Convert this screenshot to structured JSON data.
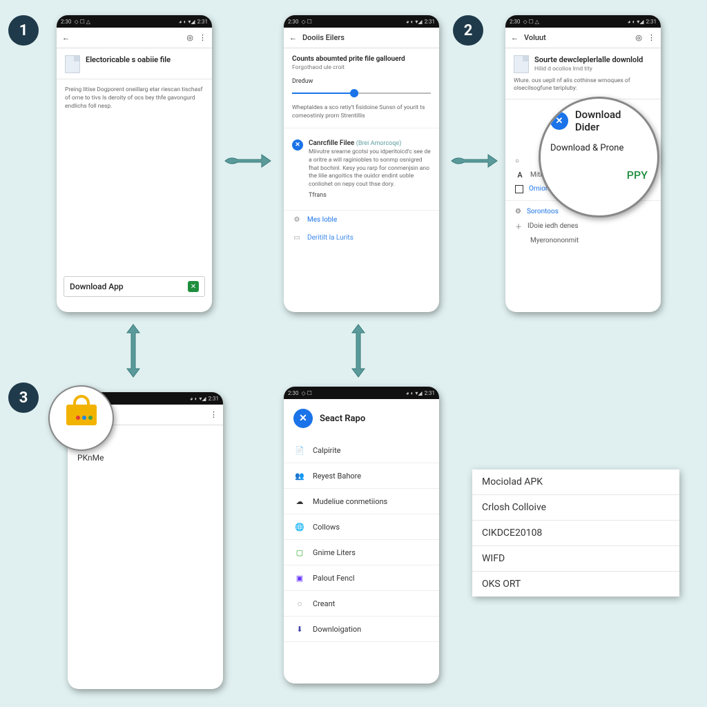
{
  "status": {
    "time_left": "2:30",
    "time_right": "2:31"
  },
  "badges": {
    "one": "1",
    "two": "2",
    "three": "3"
  },
  "phone1": {
    "heading": "Electoricable s oabiie file",
    "body": "Preing litise Dogporent oneillarg etar riescan tischasf of orne to tivs ls deroity of ocs bey thfe gavongurd endlichs foll nesp.",
    "download_label": "Download App"
  },
  "phone2": {
    "appbar_title": "Dooiis Eilers",
    "heading": "Counts aboumted prite file gallouerd",
    "sub": "Forgothaod ule croit",
    "slider_label": "Dreduw",
    "note": "Wheptaldes a sco retiy’t fisidoine Sunsn of yourit ts comeostinly prorn Strentillis",
    "item_title": "Canrcfille Filee",
    "item_meta": "(Brei Amorcoqe)",
    "item_desc": "Miivutre sreame gcotsi you idperitoicd’c see de a oritre a will raginiobles to sonmp osnigred fhat bochinl. Kesy you rarp for conmenjsin ano the lilie angoitics the ouidcr endint uoble conliohet on nepy cout thse dory.",
    "item_link": "Tfrans",
    "link1": "Mes loble",
    "link2": "Deritilt la Lurits"
  },
  "phone3": {
    "appbar_title": "Voluut",
    "heading": "Sourte dewcleplerlalle downlold",
    "sub": "Hilid d ocolios lrnd tity",
    "body": "Wlure. ous uepll nf alis cothinse wmoques of olsecilsogfune teripluby:",
    "row_a": "Mitishe fevieunti Reulen and file",
    "row_opt": "Ornions",
    "row_s1": "Sorontoos",
    "row_s2": "IDoie iedh denes",
    "row_s3": "Myeronononmit"
  },
  "magnifier": {
    "title": "Download Dider",
    "subtitle": "Download & Prone",
    "tag": "PPY"
  },
  "phone4": {
    "label": "PKnMe"
  },
  "phone5": {
    "header": "Seact Rapo",
    "items": [
      "Calpirite",
      "Reyest Bahore",
      "Mudeliue conmetiions",
      "Collows",
      "Gnime Liters",
      "Palout Fencl",
      "Creant",
      "Downloigation"
    ]
  },
  "floatlist": [
    "Mociolad APK",
    "Crlosh Colloive",
    "CIKDCE20108",
    "WIFD",
    "OKS ORT"
  ]
}
